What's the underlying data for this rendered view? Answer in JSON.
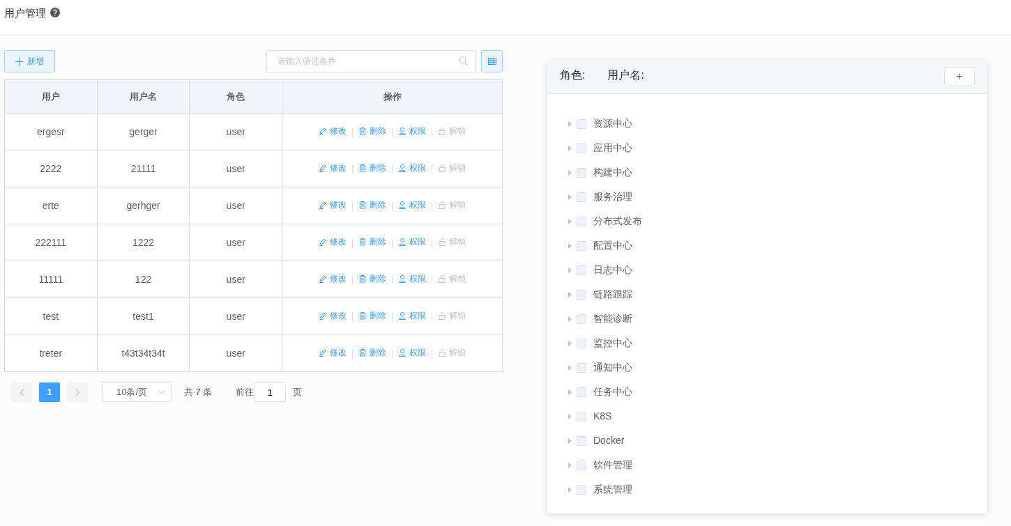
{
  "page": {
    "title": "用户管理"
  },
  "toolbar": {
    "add_button": "新增",
    "search": {
      "placeholder": "请输入筛选条件"
    }
  },
  "table": {
    "columns": [
      "用户",
      "用户名",
      "角色",
      "操作"
    ],
    "rows": [
      {
        "user": "ergesr",
        "username": "gerger",
        "role": "user",
        "actions": [
          {
            "kind": "edit",
            "label": "修改",
            "disabled": false
          },
          {
            "kind": "delete",
            "label": "删除",
            "disabled": false
          },
          {
            "kind": "permission",
            "label": "权限",
            "disabled": false
          },
          {
            "kind": "unlock",
            "label": "解锁",
            "disabled": true
          }
        ]
      },
      {
        "user": "2222",
        "username": "21111",
        "role": "user",
        "actions": [
          {
            "kind": "edit",
            "label": "修改",
            "disabled": false
          },
          {
            "kind": "delete",
            "label": "删除",
            "disabled": false
          },
          {
            "kind": "permission",
            "label": "权限",
            "disabled": false
          },
          {
            "kind": "unlock",
            "label": "解锁",
            "disabled": true
          }
        ]
      },
      {
        "user": "erte",
        "username": "gerhger",
        "role": "user",
        "actions": [
          {
            "kind": "edit",
            "label": "修改",
            "disabled": false
          },
          {
            "kind": "delete",
            "label": "删除",
            "disabled": false
          },
          {
            "kind": "permission",
            "label": "权限",
            "disabled": false
          },
          {
            "kind": "unlock",
            "label": "解锁",
            "disabled": true
          }
        ]
      },
      {
        "user": "222111",
        "username": "1222",
        "role": "user",
        "actions": [
          {
            "kind": "edit",
            "label": "修改",
            "disabled": false
          },
          {
            "kind": "delete",
            "label": "删除",
            "disabled": false
          },
          {
            "kind": "permission",
            "label": "权限",
            "disabled": false
          },
          {
            "kind": "unlock",
            "label": "解锁",
            "disabled": true
          }
        ]
      },
      {
        "user": "11111",
        "username": "122",
        "role": "user",
        "actions": [
          {
            "kind": "edit",
            "label": "修改",
            "disabled": false
          },
          {
            "kind": "delete",
            "label": "删除",
            "disabled": false
          },
          {
            "kind": "permission",
            "label": "权限",
            "disabled": false
          },
          {
            "kind": "unlock",
            "label": "解锁",
            "disabled": true
          }
        ]
      },
      {
        "user": "test",
        "username": "test1",
        "role": "user",
        "actions": [
          {
            "kind": "edit",
            "label": "修改",
            "disabled": false
          },
          {
            "kind": "delete",
            "label": "删除",
            "disabled": false
          },
          {
            "kind": "permission",
            "label": "权限",
            "disabled": false
          },
          {
            "kind": "unlock",
            "label": "解锁",
            "disabled": true
          }
        ]
      },
      {
        "user": "treter",
        "username": "t43t34t34t",
        "role": "user",
        "actions": [
          {
            "kind": "edit",
            "label": "修改",
            "disabled": false
          },
          {
            "kind": "delete",
            "label": "删除",
            "disabled": false
          },
          {
            "kind": "permission",
            "label": "权限",
            "disabled": false
          },
          {
            "kind": "unlock",
            "label": "解锁",
            "disabled": true
          }
        ]
      }
    ]
  },
  "pagination": {
    "pages": [
      {
        "label": "1",
        "selected": true
      }
    ],
    "page_size": "10条/页",
    "total": "共 7 条",
    "goto_label": "前往",
    "goto_value": "1",
    "goto_suffix": "页"
  },
  "permission_panel": {
    "role_label": "角色:",
    "username_label": "用户名:",
    "add_button": "+",
    "tree": [
      {
        "label": "资源中心",
        "checked": false,
        "expanded": false
      },
      {
        "label": "应用中心",
        "checked": false,
        "expanded": false
      },
      {
        "label": "构建中心",
        "checked": false,
        "expanded": false
      },
      {
        "label": "服务治理",
        "checked": false,
        "expanded": false
      },
      {
        "label": "分布式发布",
        "checked": false,
        "expanded": false
      },
      {
        "label": "配置中心",
        "checked": false,
        "expanded": false
      },
      {
        "label": "日志中心",
        "checked": false,
        "expanded": false
      },
      {
        "label": "链路跟踪",
        "checked": false,
        "expanded": false
      },
      {
        "label": "智能诊断",
        "checked": false,
        "expanded": false
      },
      {
        "label": "监控中心",
        "checked": false,
        "expanded": false
      },
      {
        "label": "通知中心",
        "checked": false,
        "expanded": false
      },
      {
        "label": "任务中心",
        "checked": false,
        "expanded": false
      },
      {
        "label": "K8S",
        "checked": false,
        "expanded": false
      },
      {
        "label": "Docker",
        "checked": false,
        "expanded": false
      },
      {
        "label": "软件管理",
        "checked": false,
        "expanded": false
      },
      {
        "label": "系统管理",
        "checked": false,
        "expanded": false
      }
    ]
  }
}
